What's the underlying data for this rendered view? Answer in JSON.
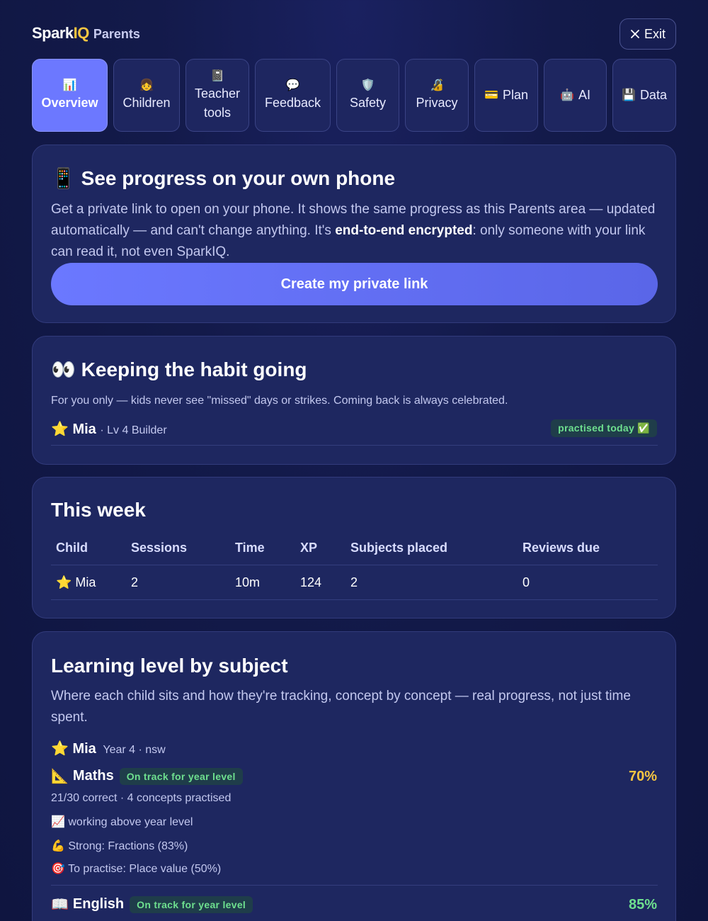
{
  "header": {
    "brand_part1": "Spark",
    "brand_part2": "IQ",
    "brand_part3": "Parents",
    "exit_label": "Exit"
  },
  "tabs": [
    {
      "icon": "📊",
      "label": "Overview",
      "active": true
    },
    {
      "icon": "👧",
      "label": "Children"
    },
    {
      "icon": "📓",
      "label_line1": "Teacher",
      "label_line2": "tools"
    },
    {
      "icon": "💬",
      "label": "Feedback"
    },
    {
      "icon": "🛡️",
      "label": "Safety"
    },
    {
      "icon": "🔏",
      "label": "Privacy"
    },
    {
      "icon": "💳",
      "label": "Plan"
    },
    {
      "icon": "🤖",
      "label": "AI"
    },
    {
      "icon": "💾",
      "label": "Data"
    }
  ],
  "phone_card": {
    "icon": "📱",
    "title": "See progress on your own phone",
    "desc_before": "Get a private link to open on your phone. It shows the same progress as this Parents area — updated automatically — and can't change anything. It's ",
    "desc_bold": "end-to-end encrypted",
    "desc_after": ": only someone with your link can read it, not even SparkIQ.",
    "cta_label": "Create my private link"
  },
  "habit_card": {
    "icon": "👀",
    "title": "Keeping the habit going",
    "note": "For you only — kids never see \"missed\" days or strikes. Coming back is always celebrated.",
    "child_icon": "⭐",
    "child_name": "Mia",
    "child_level": "· Lv 4 Builder",
    "status_badge": "practised today ✅"
  },
  "week_card": {
    "title": "This week",
    "columns": [
      "Child",
      "Sessions",
      "Time",
      "XP",
      "Subjects placed",
      "Reviews due"
    ],
    "rows": [
      [
        "⭐ Mia",
        "2",
        "10m",
        "124",
        "2",
        "0"
      ]
    ]
  },
  "level_card": {
    "title": "Learning level by subject",
    "desc": "Where each child sits and how they're tracking, concept by concept — real progress, not just time spent.",
    "child_icon": "⭐",
    "child_name": "Mia",
    "child_meta": "Year 4 · nsw",
    "subjects": [
      {
        "icon": "📐",
        "name": "Maths",
        "badge": "On track for year level",
        "percent": "70%",
        "summary": "21/30 correct · 4 concepts practised",
        "insights": [
          {
            "icon": "📈",
            "text": "working above year level"
          },
          {
            "icon": "💪",
            "text": "Strong: Fractions (83%)"
          },
          {
            "icon": "🎯",
            "text": "To practise: Place value (50%)"
          }
        ]
      },
      {
        "icon": "📖",
        "name": "English",
        "badge": "On track for year level",
        "percent": "85%"
      }
    ]
  },
  "colors": {
    "accent": "#6c78ff",
    "amber": "#f5c542",
    "green": "#6ee08f"
  }
}
